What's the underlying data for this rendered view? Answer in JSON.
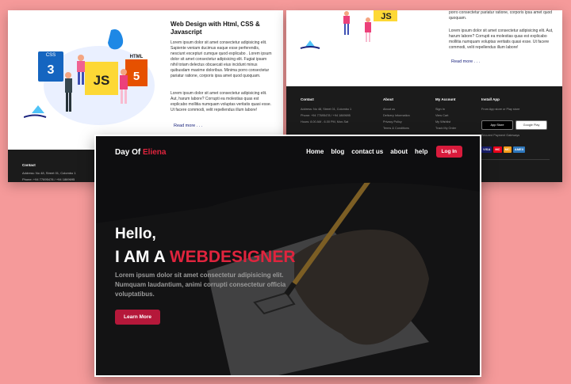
{
  "colors": {
    "background": "#f59a9a",
    "accent": "#e0243d",
    "button": "#d81b3c",
    "footer": "#1b1b1b"
  },
  "left_preview": {
    "blog_title": "Web Design with Html, CSS & Javascript",
    "paragraph_1": "Lorem ipsum dolor sit amet consectetur adipisicing elit. Sapiente veniam ducimus eaque esse perferendis, nesciunt excepturi cumque quod explicabo . Lorem ipsum dolor sit amet consectetur adipisicing elit. Fugiat ipsam nihil totam delectus obcaecati eius incidunt minus quibusdam maxime doloribus. Minima porro consectetur pariatur ratione, corporis ipsa amet quod quoquam.",
    "paragraph_2": "Lorem ipsum dolor sit amet consectetur adipisicing elit. Aut, harum labore? Corrupti ea molestias quas est explicabo mollitia numquam voluptas veritatis quasi esse. Ut facere commodi, velit repellendus illum labore!",
    "read_more": "Read more . . .",
    "illustration": {
      "css_badge": "CSS",
      "js_badge": "JS",
      "html_badge": "HTML"
    },
    "footer": {
      "heading": "Contact",
      "line_1": "Address: No 48, Street 01, Colombo 1",
      "line_2": "Phone: +94 77695478 / +94 1869695"
    }
  },
  "right_preview": {
    "paragraph_1": "porro consectetur pariatur ratione, corporis ipsa amet quod quoquam.",
    "paragraph_2": "Lorem ipsum dolor sit amet consectetur adipisicing elit. Aut, harum labore? Corrupti ea molestias quas est explicabo mollitia numquam voluptas veritatis quasi esse. Ut facere commodi, velit repellendus illum labore!",
    "read_more": "Read more . . .",
    "illustration": {
      "js_badge": "JS"
    },
    "footer": {
      "contact": {
        "heading": "Contact",
        "items": [
          "Address: No 48, Street 01, Colombo 1",
          "Phone: +94 77695478 / +94 1869695",
          "Hours: 8.00 AM - 6.00 PM, Mon-Sat"
        ]
      },
      "about": {
        "heading": "About",
        "items": [
          "About us",
          "Delivery Information",
          "Privacy Policy",
          "Terms & Conditions"
        ]
      },
      "account": {
        "heading": "My Account",
        "items": [
          "Sign In",
          "View Cart",
          "My Wishlist",
          "Track My Order"
        ]
      },
      "install": {
        "heading": "Install App",
        "sub": "From App store or Play store",
        "app_store": "App Store",
        "google_play": "Google Play",
        "payment_heading": "Secured Payment Gateways",
        "payments": [
          "VISA",
          "MC",
          "MC",
          "AMEX"
        ]
      }
    }
  },
  "hero": {
    "brand": {
      "name": "Day Of ",
      "accent": "Eliena"
    },
    "nav": [
      "Home",
      "blog",
      "contact us",
      "about",
      "help"
    ],
    "login": "Log In",
    "hello": "Hello,",
    "role_prefix": "I AM A ",
    "role_accent": "WEBDESIGNER",
    "lead": "Lorem ipsum dolor sit amet consectetur adipisicing elit. Numquam laudantium, animi corrupti consectetur officia voluptatibus.",
    "cta": "Learn More"
  }
}
